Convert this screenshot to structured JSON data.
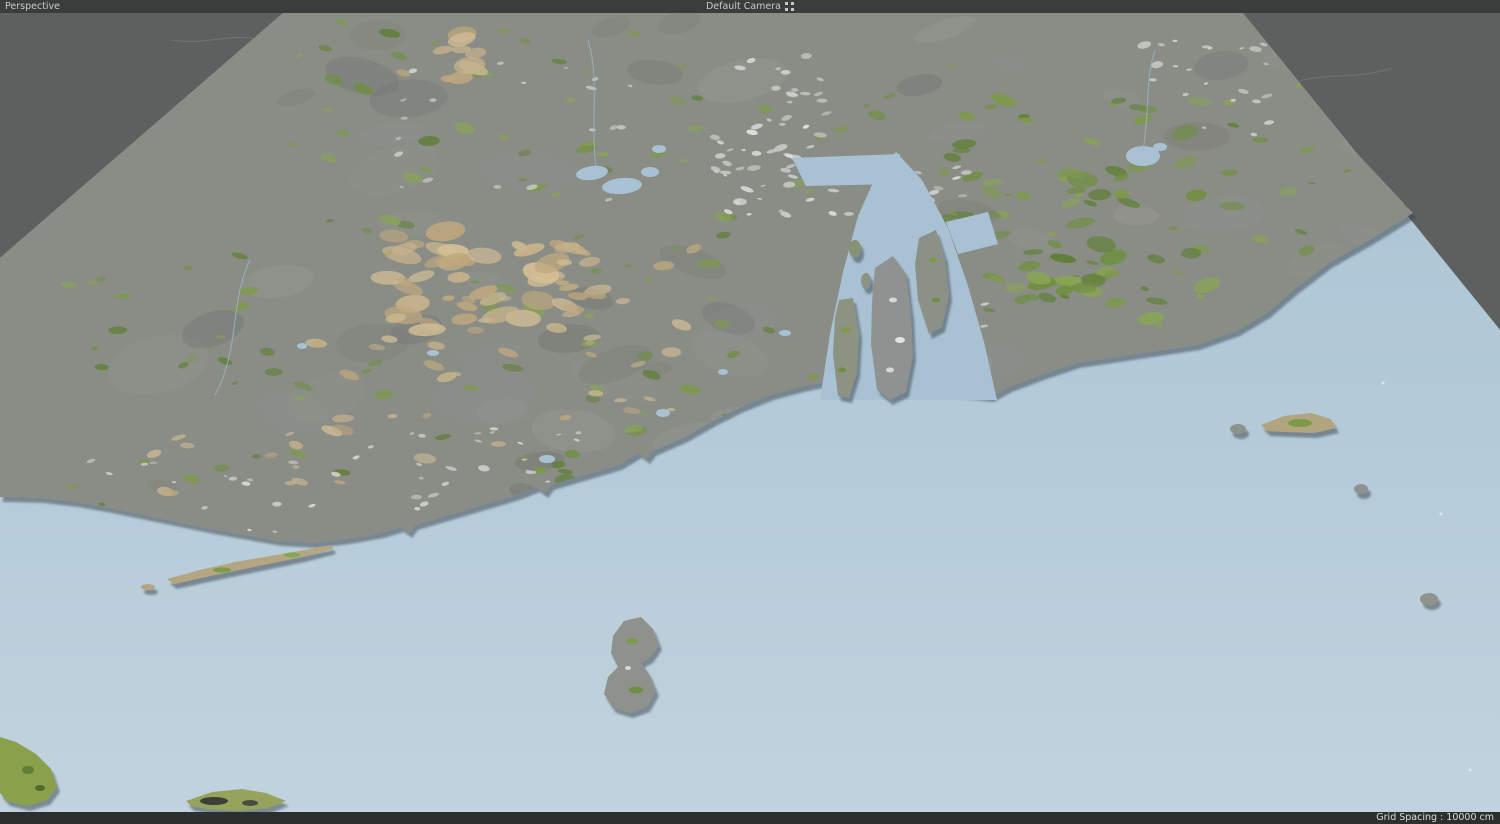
{
  "top_bar": {
    "view_label": "Perspective",
    "camera_label": "Default Camera"
  },
  "status_bar": {
    "grid_spacing": "Grid Spacing : 10000 cm"
  },
  "viewport": {
    "colors": {
      "background": "#5e605f",
      "bar": "#3b3d3d",
      "bar_text": "#c9c9c9",
      "water_near": "#c1d3de",
      "water_far": "#a8c2d4",
      "land_base": "#8a8d86",
      "shadow": "#39414c",
      "green": [
        "#6f8f3f",
        "#7d9a48",
        "#5f7f35",
        "#88a454"
      ],
      "tan": [
        "#c9b48c",
        "#d3be96",
        "#bfa87e"
      ],
      "urban": [
        "#d6d8d5",
        "#c8cbc8",
        "#e2e4e1"
      ],
      "gray_light": [
        "#969993",
        "#8f938e"
      ],
      "gray_dark": [
        "#75796f",
        "#6d716b"
      ]
    }
  }
}
